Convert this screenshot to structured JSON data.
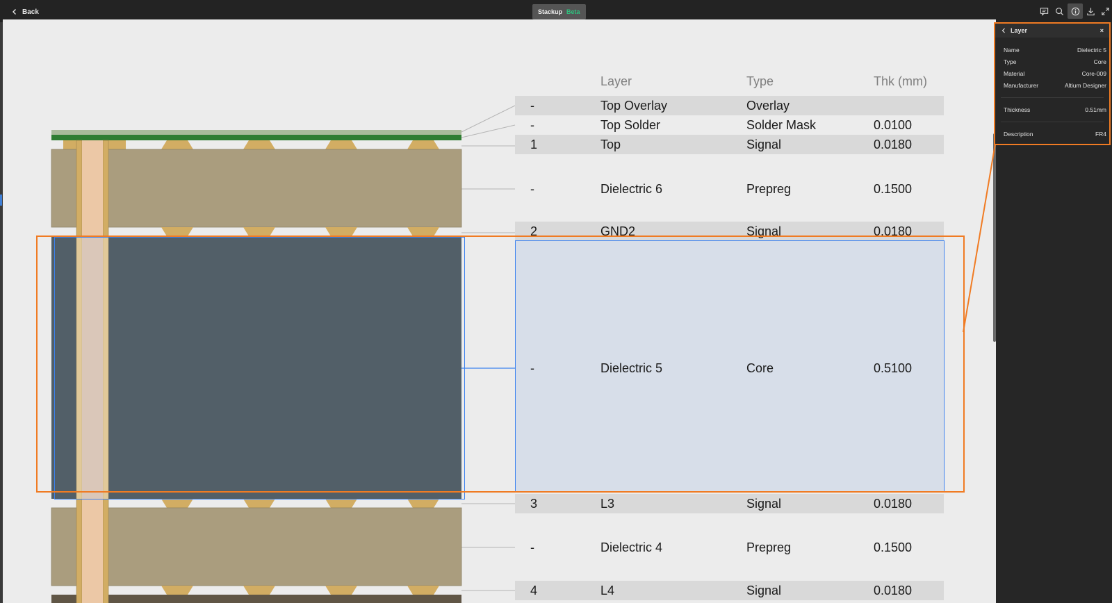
{
  "topbar": {
    "back_label": "Back",
    "title": "Stackup",
    "badge": "Beta",
    "icons": [
      "comment-icon",
      "search-icon",
      "info-icon",
      "download-icon",
      "expand-icon"
    ]
  },
  "table": {
    "headers": {
      "layer": "Layer",
      "type": "Type",
      "thk": "Thk (mm)"
    },
    "rows": [
      {
        "num": "-",
        "layer": "Top Overlay",
        "type": "Overlay",
        "thk": ""
      },
      {
        "num": "-",
        "layer": "Top Solder",
        "type": "Solder Mask",
        "thk": "0.0100"
      },
      {
        "num": "1",
        "layer": "Top",
        "type": "Signal",
        "thk": "0.0180"
      },
      {
        "num": "-",
        "layer": "Dielectric 6",
        "type": "Prepreg",
        "thk": "0.1500"
      },
      {
        "num": "2",
        "layer": "GND2",
        "type": "Signal",
        "thk": "0.0180"
      },
      {
        "num": "-",
        "layer": "Dielectric 5",
        "type": "Core",
        "thk": "0.5100"
      },
      {
        "num": "3",
        "layer": "L3",
        "type": "Signal",
        "thk": "0.0180"
      },
      {
        "num": "-",
        "layer": "Dielectric 4",
        "type": "Prepreg",
        "thk": "0.1500"
      },
      {
        "num": "4",
        "layer": "L4",
        "type": "Signal",
        "thk": "0.0180"
      }
    ]
  },
  "panel": {
    "title": "Layer",
    "close": "×",
    "name_label": "Name",
    "name_value": "Dielectric 5",
    "type_label": "Type",
    "type_value": "Core",
    "material_label": "Material",
    "material_value": "Core-009",
    "manufacturer_label": "Manufacturer",
    "manufacturer_value": "Altium Designer",
    "thickness_label": "Thickness",
    "thickness_value": "0.51mm",
    "description_label": "Description",
    "description_value": "FR4"
  },
  "colors": {
    "accent_orange": "#f07b23",
    "selection_blue": "#3c82f0",
    "beta_green": "#2ec27e",
    "prepreg": "#aa9d7e",
    "core": "#525f68",
    "copper": "#d2ad63",
    "solder_mask": "#2e7d32"
  }
}
